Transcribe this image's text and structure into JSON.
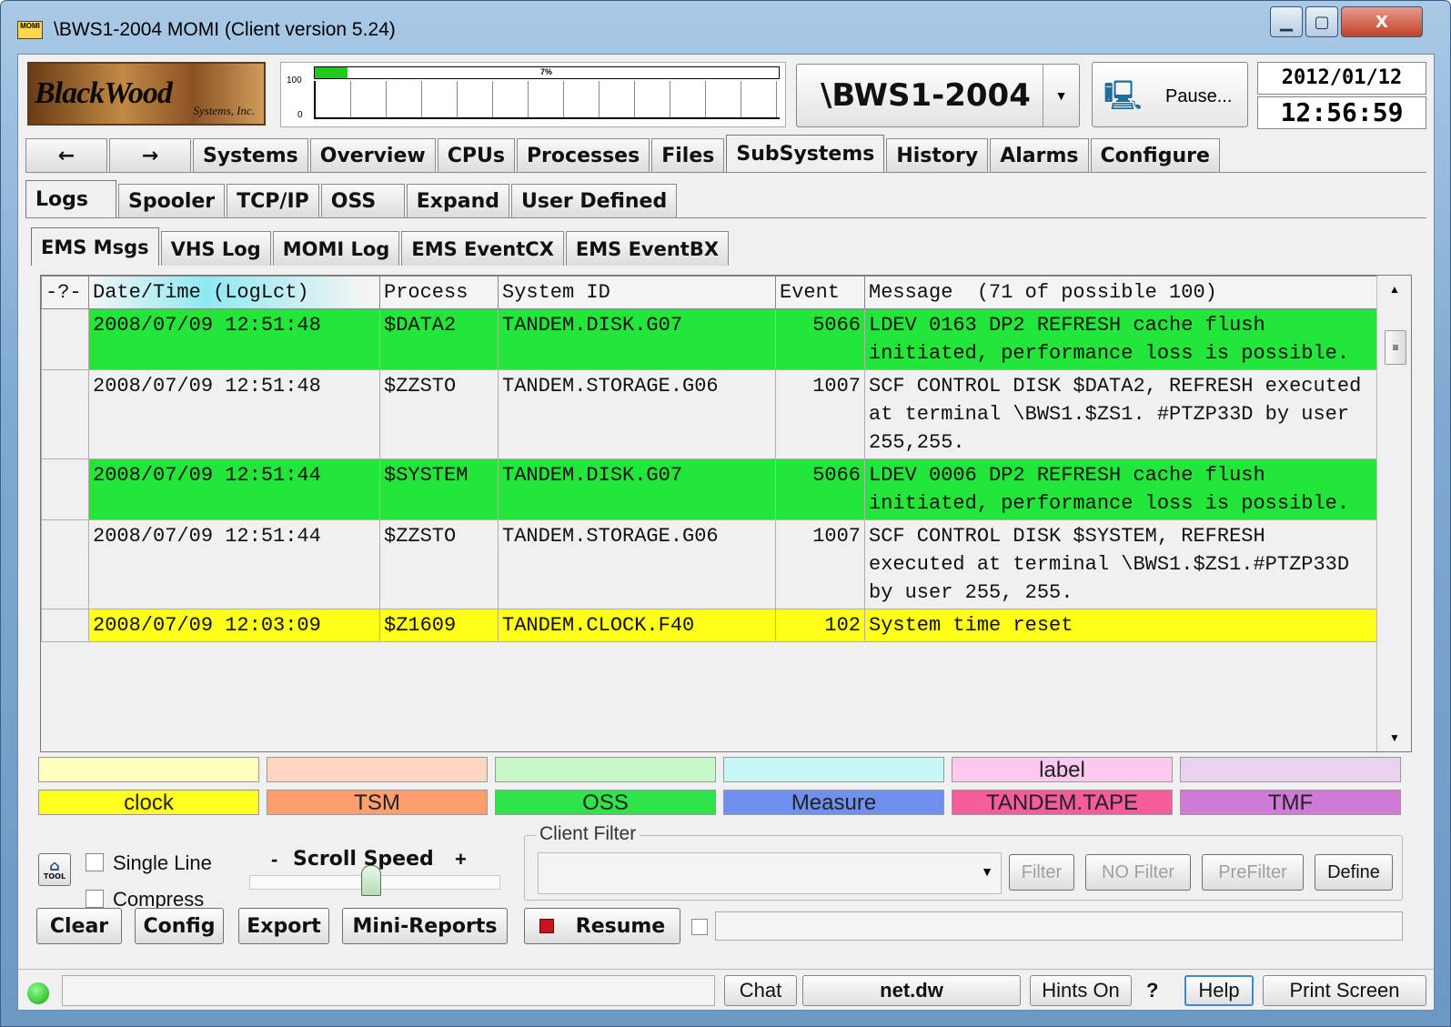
{
  "window": {
    "title": "\\BWS1-2004 MOMI (Client version 5.24)",
    "icon_text": "MOMI",
    "minimize_glyph": "▁",
    "maximize_glyph": "▢",
    "close_glyph": "X"
  },
  "header": {
    "logo_main": "BlackWood",
    "logo_sub": "Systems, Inc.",
    "cpu_label_max": "100",
    "cpu_label_min": "0",
    "cpu_percent_text": "7%",
    "cpu_usage": 0.07,
    "system_name": "\\BWS1-2004",
    "pause_label": "Pause...",
    "date": "2012/01/12",
    "time": "12:56:59"
  },
  "main_tabs": {
    "back": "←",
    "forward": "→",
    "items": [
      "Systems",
      "Overview",
      "CPUs",
      "Processes",
      "Files",
      "SubSystems",
      "History",
      "Alarms",
      "Configure"
    ],
    "selected": "SubSystems"
  },
  "sub_tabs": {
    "items": [
      "Logs",
      "Spooler",
      "TCP/IP",
      "OSS",
      "Expand",
      "User Defined"
    ],
    "selected": "Logs"
  },
  "log_tabs": {
    "items": [
      "EMS Msgs",
      "VHS Log",
      "MOMI Log",
      "EMS EventCX",
      "EMS EventBX"
    ],
    "selected": "EMS Msgs"
  },
  "grid": {
    "columns": [
      "-?-",
      "Date/Time (LogLct)",
      "Process",
      "System ID",
      "Event",
      "Message  (71 of possible 100)"
    ],
    "rows": [
      {
        "datetime": "2008/07/09 12:51:48",
        "process": "$DATA2",
        "system_id": "TANDEM.DISK.G07",
        "event": "5066",
        "message": "LDEV 0163 DP2 REFRESH cache flush initiated, performance loss is possible.",
        "color": "#22e63a"
      },
      {
        "datetime": "2008/07/09 12:51:48",
        "process": "$ZZSTO",
        "system_id": "TANDEM.STORAGE.G06",
        "event": "1007",
        "message": "SCF CONTROL DISK $DATA2, REFRESH executed at terminal \\BWS1.$ZS1. #PTZP33D by user 255,255.",
        "color": "#f0f0f0"
      },
      {
        "datetime": "2008/07/09 12:51:44",
        "process": "$SYSTEM",
        "system_id": "TANDEM.DISK.G07",
        "event": "5066",
        "message": "LDEV 0006 DP2 REFRESH cache flush initiated, performance loss is possible.",
        "color": "#22e63a"
      },
      {
        "datetime": "2008/07/09 12:51:44",
        "process": "$ZZSTO",
        "system_id": "TANDEM.STORAGE.G06",
        "event": "1007",
        "message": "SCF CONTROL DISK $SYSTEM, REFRESH executed at terminal \\BWS1.$ZS1.#PTZP33D by user 255, 255.",
        "color": "#f0f0f0"
      },
      {
        "datetime": "2008/07/09 12:03:09",
        "process": "$Z1609",
        "system_id": "TANDEM.CLOCK.F40",
        "event": "102",
        "message": "System time reset",
        "color": "#ffff1a"
      }
    ]
  },
  "legend": {
    "top": [
      {
        "label": "",
        "color": "#ffffc0"
      },
      {
        "label": "",
        "color": "#ffd7c0"
      },
      {
        "label": "",
        "color": "#c8f7c8"
      },
      {
        "label": "",
        "color": "#c8f7f7"
      },
      {
        "label": "label",
        "color": "#fbc8f0"
      },
      {
        "label": "",
        "color": "#e8d2ee"
      }
    ],
    "bottom": [
      {
        "label": "clock",
        "color": "#ffff22"
      },
      {
        "label": "TSM",
        "color": "#ff9e6e"
      },
      {
        "label": "OSS",
        "color": "#2fe44a"
      },
      {
        "label": "Measure",
        "color": "#7090f0"
      },
      {
        "label": "TANDEM.TAPE",
        "color": "#f45c9a"
      },
      {
        "label": "TMF",
        "color": "#d07ad8"
      }
    ]
  },
  "controls": {
    "tool_label": "TOOL",
    "single_line": "Single Line",
    "compress": "Compress",
    "scroll_speed_minus": "-",
    "scroll_speed": "Scroll Speed",
    "scroll_speed_plus": "+",
    "client_filter": "Client Filter",
    "filter": "Filter",
    "no_filter": "NO Filter",
    "prefilter": "PreFilter",
    "define": "Define",
    "clear": "Clear",
    "config": "Config",
    "export": "Export",
    "mini_reports": "Mini-Reports",
    "resume": "Resume"
  },
  "statusbar": {
    "chat": "Chat",
    "server": "net.dw",
    "hints": "Hints On",
    "question": "?",
    "help": "Help",
    "print_screen": "Print Screen"
  }
}
